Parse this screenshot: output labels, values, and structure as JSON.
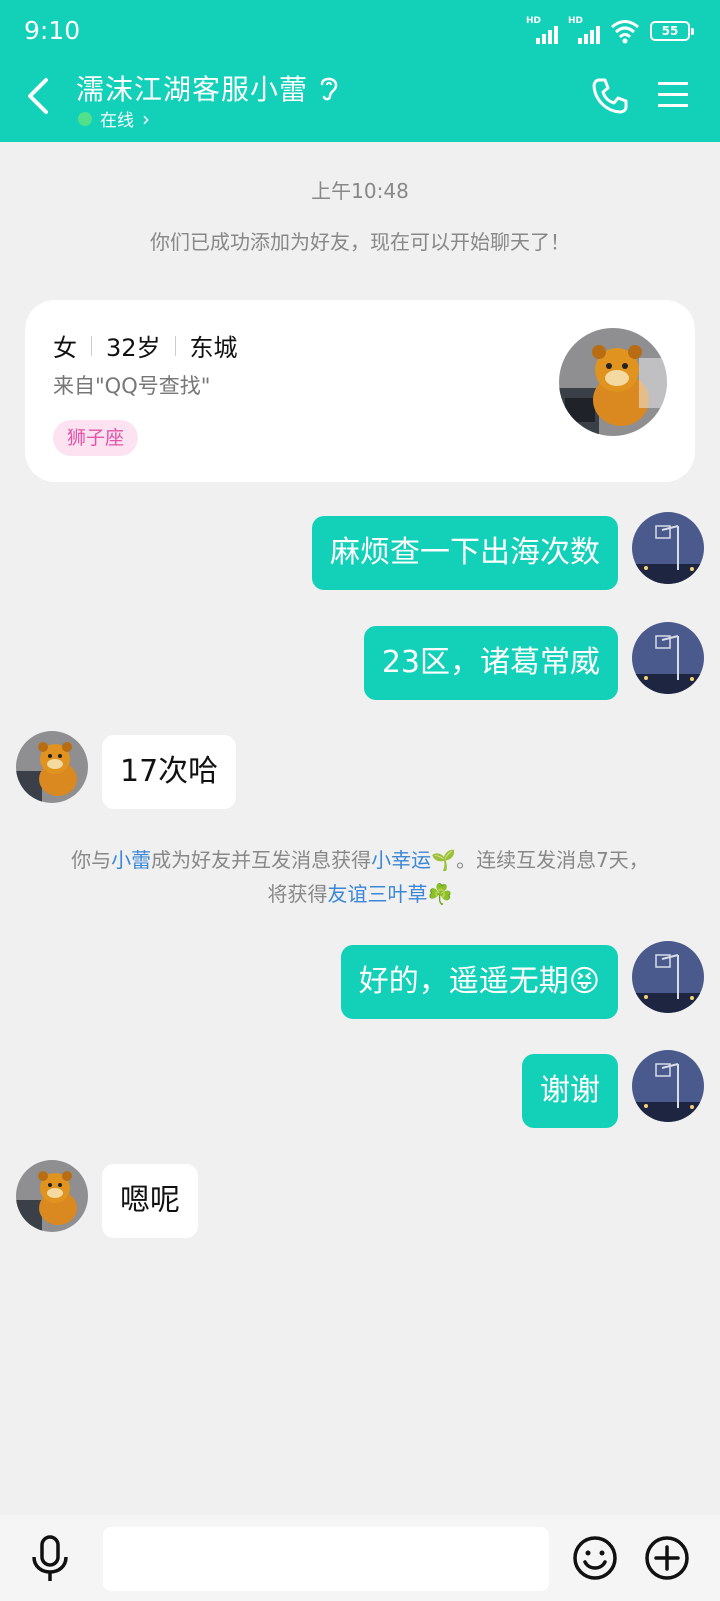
{
  "status": {
    "time": "9:10",
    "hd1": "HD",
    "hd2": "HD",
    "battery": "55"
  },
  "header": {
    "name": "濡沫江湖客服小蕾",
    "status": "在线",
    "status_arrow": "›"
  },
  "timestamp": "上午10:48",
  "system_added": "你们已成功添加为好友，现在可以开始聊天了！",
  "profile_card": {
    "gender": "女",
    "age": "32岁",
    "city": "东城",
    "source": "来自\"QQ号查找\"",
    "tag": "狮子座"
  },
  "messages": [
    {
      "text": "麻烦查一下出海次数",
      "direction": "out"
    },
    {
      "text": "23区，诸葛常威",
      "direction": "out"
    },
    {
      "text": "17次哈",
      "direction": "in"
    },
    {
      "text": "好的，遥遥无期",
      "direction": "out",
      "emoji": "😝"
    },
    {
      "text": "谢谢",
      "direction": "out"
    },
    {
      "text": "嗯呢",
      "direction": "in"
    }
  ],
  "system_luck": {
    "p1": "你与",
    "name": "小蕾",
    "p2": "成为好友并互发消息获得",
    "luck": "小幸运",
    "luck_icon": "🌱",
    "p3": "。连续互发消息7天，",
    "p4": "将获得",
    "reward": "友谊三叶草",
    "reward_icon": "☘️"
  },
  "colors": {
    "accent": "#13d1b8",
    "link": "#3b87d6",
    "tag_bg": "#fde3f1",
    "tag_text": "#e254a8",
    "online": "#52e08a"
  },
  "icons": [
    "back-icon",
    "ear-icon",
    "phone-icon",
    "menu-icon",
    "mic-icon",
    "emoji-icon",
    "plus-icon"
  ]
}
